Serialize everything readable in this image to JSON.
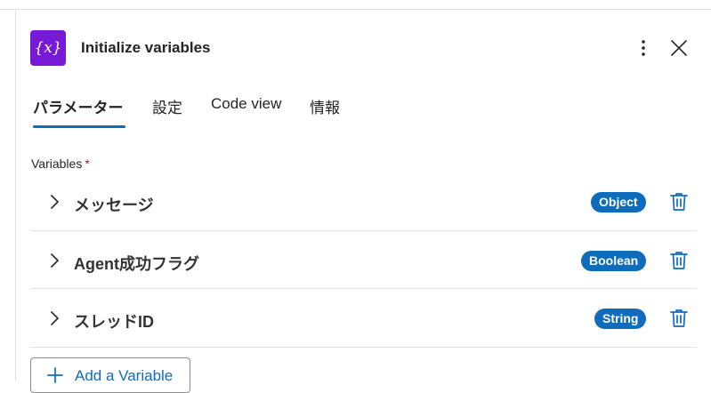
{
  "header": {
    "icon_glyph": "{x}",
    "title": "Initialize variables"
  },
  "tabs": [
    {
      "label": "パラメーター",
      "active": true
    },
    {
      "label": "設定",
      "active": false
    },
    {
      "label": "Code view",
      "active": false
    },
    {
      "label": "情報",
      "active": false
    }
  ],
  "variables_section": {
    "label": "Variables",
    "required_marker": "*"
  },
  "variables": [
    {
      "name": "メッセージ",
      "type": "Object"
    },
    {
      "name": "Agent成功フラグ",
      "type": "Boolean"
    },
    {
      "name": "スレッドID",
      "type": "String"
    }
  ],
  "add_button": {
    "label": "Add a Variable"
  },
  "colors": {
    "icon_bg": "#7719d6",
    "accent": "#0f6cbd",
    "required": "#c50f1f"
  },
  "icons": {
    "more": "more-vertical-icon",
    "close": "close-icon",
    "chevron": "chevron-right-icon",
    "delete": "trash-icon",
    "add": "plus-icon"
  }
}
